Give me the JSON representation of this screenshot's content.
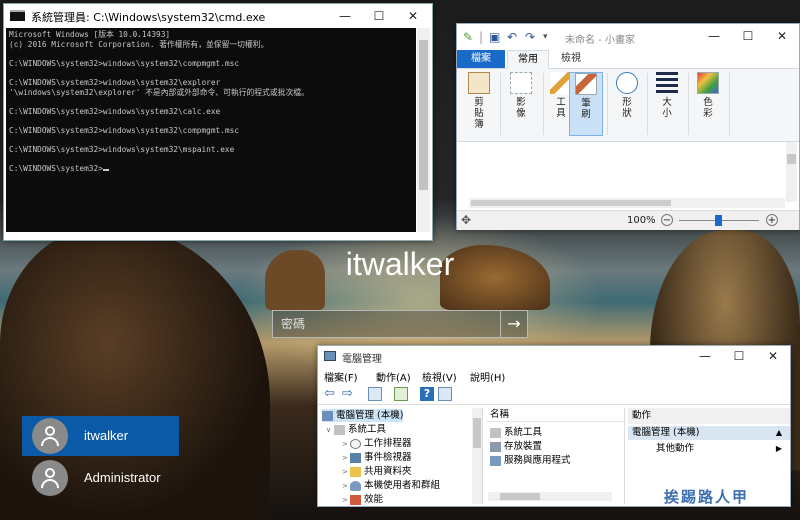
{
  "lockscreen": {
    "username": "itwalker",
    "password_placeholder": "密碼",
    "submit_arrow": "→",
    "users": [
      {
        "name": "itwalker",
        "selected": true
      },
      {
        "name": "Administrator",
        "selected": false
      }
    ]
  },
  "cmd": {
    "title": "系統管理員: C:\\Windows\\system32\\cmd.exe",
    "lines": [
      "Microsoft Windows [版本 10.0.14393]",
      "(c) 2016 Microsoft Corporation. 著作權所有，並保留一切權利。",
      "",
      "C:\\WINDOWS\\system32>windows\\system32\\compmgmt.msc",
      "",
      "C:\\WINDOWS\\system32>windows\\system32\\explorer",
      "'\\windows\\system32\\explorer' 不是內部或外部命令、可執行的程式或批次檔。",
      "",
      "C:\\WINDOWS\\system32>windows\\system32\\calc.exe",
      "",
      "C:\\WINDOWS\\system32>windows\\system32\\compmgmt.msc",
      "",
      "C:\\WINDOWS\\system32>windows\\system32\\mspaint.exe",
      "",
      "C:\\WINDOWS\\system32>"
    ]
  },
  "paint": {
    "title": "未命名 - 小畫家",
    "tabs": {
      "file": "檔案",
      "home": "常用",
      "view": "檢視"
    },
    "groups": [
      {
        "label": "剪貼簿"
      },
      {
        "label": "影像"
      },
      {
        "label": "工具"
      },
      {
        "label": "筆刷"
      },
      {
        "label": "形狀"
      },
      {
        "label": "大小"
      },
      {
        "label": "色彩"
      }
    ],
    "zoom": "100%",
    "zoom_minus": "−",
    "zoom_plus": "+"
  },
  "mgmt": {
    "title": "電腦管理",
    "menu": [
      "檔案(F)",
      "動作(A)",
      "檢視(V)",
      "說明(H)"
    ],
    "tree": [
      {
        "label": "電腦管理 (本機)",
        "level": 0
      },
      {
        "label": "系統工具",
        "level": 1
      },
      {
        "label": "工作排程器",
        "level": 2
      },
      {
        "label": "事件檢視器",
        "level": 2
      },
      {
        "label": "共用資料夾",
        "level": 2
      },
      {
        "label": "本機使用者和群組",
        "level": 2
      },
      {
        "label": "效能",
        "level": 2
      }
    ],
    "list_header": "名稱",
    "list_items": [
      "系統工具",
      "存放裝置",
      "服務與應用程式"
    ],
    "actions_header": "動作",
    "actions_selected": "電腦管理 (本機)",
    "actions_more": "其他動作"
  },
  "watermark": "挨踢路人甲",
  "colors": {
    "accent": "#1a6ac7",
    "selected_user": "#0a5aa8",
    "console_bg": "#0c0c0c"
  }
}
